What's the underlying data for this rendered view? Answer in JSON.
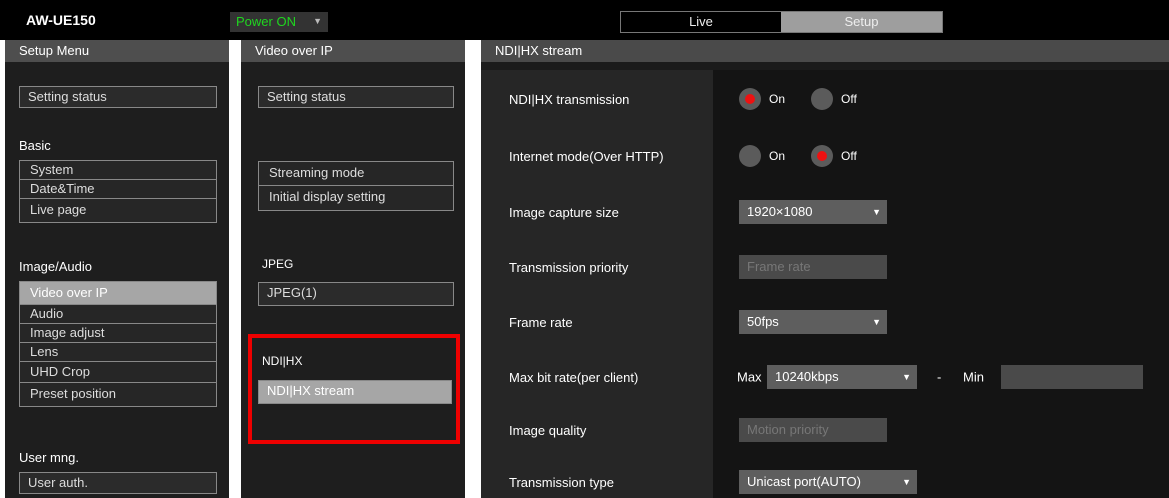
{
  "header": {
    "model": "AW-UE150",
    "power_label": "Power ON",
    "tabs": [
      {
        "label": "Live"
      },
      {
        "label": "Setup"
      }
    ]
  },
  "setup_menu": {
    "title": "Setup Menu",
    "setting_status": "Setting status",
    "groups": [
      {
        "label": "Basic",
        "items": [
          "System",
          "Date&Time",
          "Live page"
        ]
      },
      {
        "label": "Image/Audio",
        "items": [
          "Video over IP",
          "Audio",
          "Image adjust",
          "Lens",
          "UHD Crop",
          "Preset position"
        ]
      },
      {
        "label": "User mng.",
        "items": [
          "User auth."
        ]
      }
    ]
  },
  "sub_menu": {
    "title": "Video over IP",
    "setting_status": "Setting status",
    "items": [
      "Streaming mode",
      "Initial display setting"
    ],
    "jpeg_label": "JPEG",
    "jpeg_item": "JPEG(1)",
    "ndi_label": "NDI|HX",
    "ndi_item": "NDI|HX stream"
  },
  "main": {
    "title": "NDI|HX stream",
    "rows": {
      "transmission": {
        "label": "NDI|HX transmission",
        "on": "On",
        "off": "Off",
        "value": "On"
      },
      "internet": {
        "label": "Internet mode(Over HTTP)",
        "on": "On",
        "off": "Off",
        "value": "Off"
      },
      "capture": {
        "label": "Image capture size",
        "value": "1920×1080"
      },
      "priority": {
        "label": "Transmission priority",
        "value": "Frame rate"
      },
      "framerate": {
        "label": "Frame rate",
        "value": "50fps"
      },
      "bitrate": {
        "label": "Max bit rate(per client)",
        "max_label": "Max",
        "max_value": "10240kbps",
        "dash": "-",
        "min_label": "Min"
      },
      "quality": {
        "label": "Image quality",
        "value": "Motion priority"
      },
      "type": {
        "label": "Transmission type",
        "value": "Unicast port(AUTO)"
      }
    }
  },
  "colors": {
    "accent_on": "#e11111",
    "power_green": "#1fd61f",
    "highlight": "#ee0000"
  }
}
